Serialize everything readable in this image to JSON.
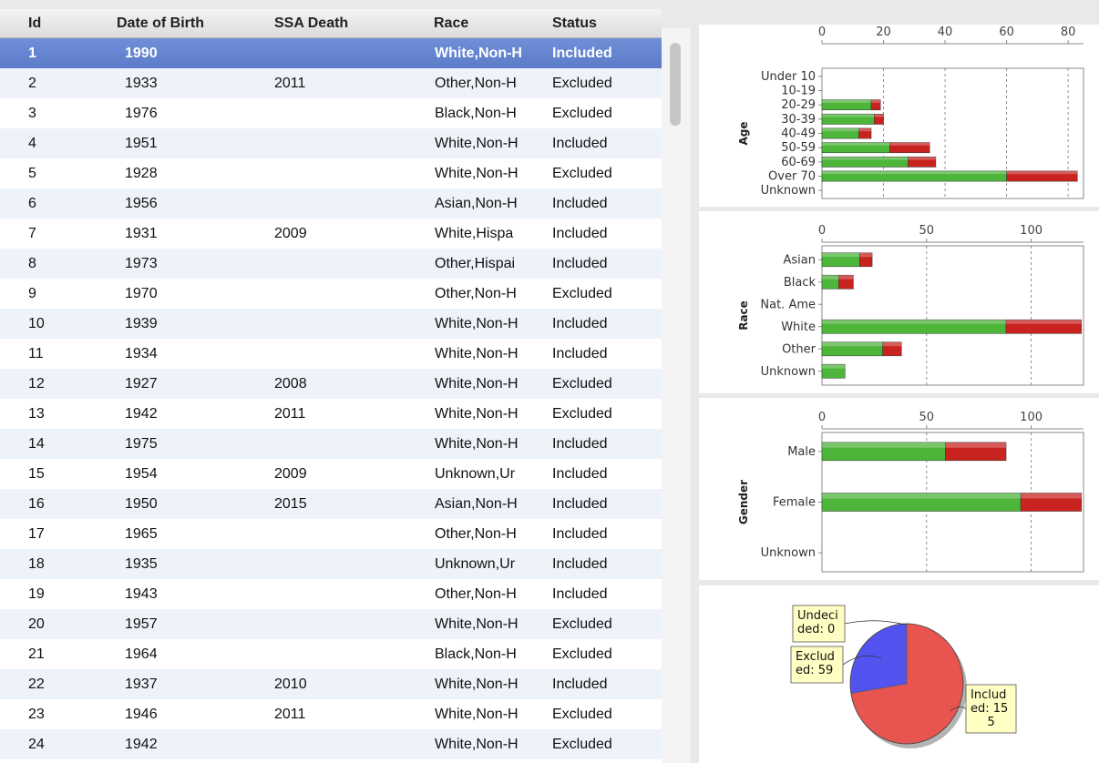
{
  "table": {
    "columns": [
      "Id",
      "Date of Birth",
      "SSA Death",
      "Race",
      "Status"
    ],
    "rows": [
      {
        "id": "1",
        "dob": "1990",
        "ssa": "",
        "race": "White,Non-H",
        "status": "Included",
        "selected": true
      },
      {
        "id": "2",
        "dob": "1933",
        "ssa": "2011",
        "race": "Other,Non-H",
        "status": "Excluded"
      },
      {
        "id": "3",
        "dob": "1976",
        "ssa": "",
        "race": "Black,Non-H",
        "status": "Excluded"
      },
      {
        "id": "4",
        "dob": "1951",
        "ssa": "",
        "race": "White,Non-H",
        "status": "Included"
      },
      {
        "id": "5",
        "dob": "1928",
        "ssa": "",
        "race": "White,Non-H",
        "status": "Excluded"
      },
      {
        "id": "6",
        "dob": "1956",
        "ssa": "",
        "race": "Asian,Non-H",
        "status": "Included"
      },
      {
        "id": "7",
        "dob": "1931",
        "ssa": "2009",
        "race": "White,Hispa",
        "status": "Included"
      },
      {
        "id": "8",
        "dob": "1973",
        "ssa": "",
        "race": "Other,Hispai",
        "status": "Included"
      },
      {
        "id": "9",
        "dob": "1970",
        "ssa": "",
        "race": "Other,Non-H",
        "status": "Excluded"
      },
      {
        "id": "10",
        "dob": "1939",
        "ssa": "",
        "race": "White,Non-H",
        "status": "Included"
      },
      {
        "id": "11",
        "dob": "1934",
        "ssa": "",
        "race": "White,Non-H",
        "status": "Included"
      },
      {
        "id": "12",
        "dob": "1927",
        "ssa": "2008",
        "race": "White,Non-H",
        "status": "Excluded"
      },
      {
        "id": "13",
        "dob": "1942",
        "ssa": "2011",
        "race": "White,Non-H",
        "status": "Excluded"
      },
      {
        "id": "14",
        "dob": "1975",
        "ssa": "",
        "race": "White,Non-H",
        "status": "Included"
      },
      {
        "id": "15",
        "dob": "1954",
        "ssa": "2009",
        "race": "Unknown,Ur",
        "status": "Included"
      },
      {
        "id": "16",
        "dob": "1950",
        "ssa": "2015",
        "race": "Asian,Non-H",
        "status": "Included"
      },
      {
        "id": "17",
        "dob": "1965",
        "ssa": "",
        "race": "Other,Non-H",
        "status": "Included"
      },
      {
        "id": "18",
        "dob": "1935",
        "ssa": "",
        "race": "Unknown,Ur",
        "status": "Included"
      },
      {
        "id": "19",
        "dob": "1943",
        "ssa": "",
        "race": "Other,Non-H",
        "status": "Included"
      },
      {
        "id": "20",
        "dob": "1957",
        "ssa": "",
        "race": "White,Non-H",
        "status": "Excluded"
      },
      {
        "id": "21",
        "dob": "1964",
        "ssa": "",
        "race": "Black,Non-H",
        "status": "Excluded"
      },
      {
        "id": "22",
        "dob": "1937",
        "ssa": "2010",
        "race": "White,Non-H",
        "status": "Included"
      },
      {
        "id": "23",
        "dob": "1946",
        "ssa": "2011",
        "race": "White,Non-H",
        "status": "Excluded"
      },
      {
        "id": "24",
        "dob": "1942",
        "ssa": "",
        "race": "White,Non-H",
        "status": "Excluded"
      }
    ]
  },
  "colors": {
    "included": "#4cb53a",
    "excluded": "#c8231f",
    "pie_included": "#e85550",
    "pie_excluded": "#5353f0",
    "selection": "#6485d0",
    "tooltip_bg": "#ffffc4"
  },
  "chart_data": [
    {
      "type": "bar",
      "orientation": "horizontal",
      "stacked": true,
      "ylabel": "Age",
      "categories": [
        "Under 10",
        "10-19",
        "20-29",
        "30-39",
        "40-49",
        "50-59",
        "60-69",
        "Over 70",
        "Unknown"
      ],
      "series": [
        {
          "key": "included",
          "values": [
            0,
            0,
            16,
            17,
            12,
            22,
            28,
            60,
            0
          ]
        },
        {
          "key": "excluded",
          "values": [
            0,
            0,
            3,
            3,
            4,
            13,
            9,
            23,
            0
          ]
        }
      ],
      "xlim": [
        0,
        85
      ],
      "ticks": [
        0,
        20,
        40,
        60,
        80
      ],
      "grid": "vertical dashed"
    },
    {
      "type": "bar",
      "orientation": "horizontal",
      "stacked": true,
      "ylabel": "Race",
      "categories": [
        "Asian",
        "Black",
        "Nat. Ame",
        "White",
        "Other",
        "Unknown"
      ],
      "series": [
        {
          "key": "included",
          "values": [
            18,
            8,
            0,
            88,
            29,
            11
          ]
        },
        {
          "key": "excluded",
          "values": [
            6,
            7,
            0,
            36,
            9,
            0
          ]
        }
      ],
      "xlim": [
        0,
        125
      ],
      "ticks": [
        0,
        50,
        100
      ],
      "grid": "vertical dashed"
    },
    {
      "type": "bar",
      "orientation": "horizontal",
      "stacked": true,
      "ylabel": "Gender",
      "categories": [
        "Male",
        "Female",
        "Unknown"
      ],
      "series": [
        {
          "key": "included",
          "values": [
            59,
            95,
            0
          ]
        },
        {
          "key": "excluded",
          "values": [
            29,
            29,
            0
          ]
        }
      ],
      "xlim": [
        0,
        125
      ],
      "ticks": [
        0,
        50,
        100
      ],
      "grid": "vertical dashed"
    },
    {
      "type": "pie",
      "slices": [
        {
          "key": "undecided",
          "label_lines": [
            "Undeci",
            "ded: 0"
          ],
          "value": 0
        },
        {
          "key": "excluded",
          "label_lines": [
            "Exclud",
            "ed: 59"
          ],
          "value": 59
        },
        {
          "key": "included",
          "label_lines": [
            "Includ",
            "ed: 15",
            "5"
          ],
          "value": 155
        }
      ]
    }
  ]
}
